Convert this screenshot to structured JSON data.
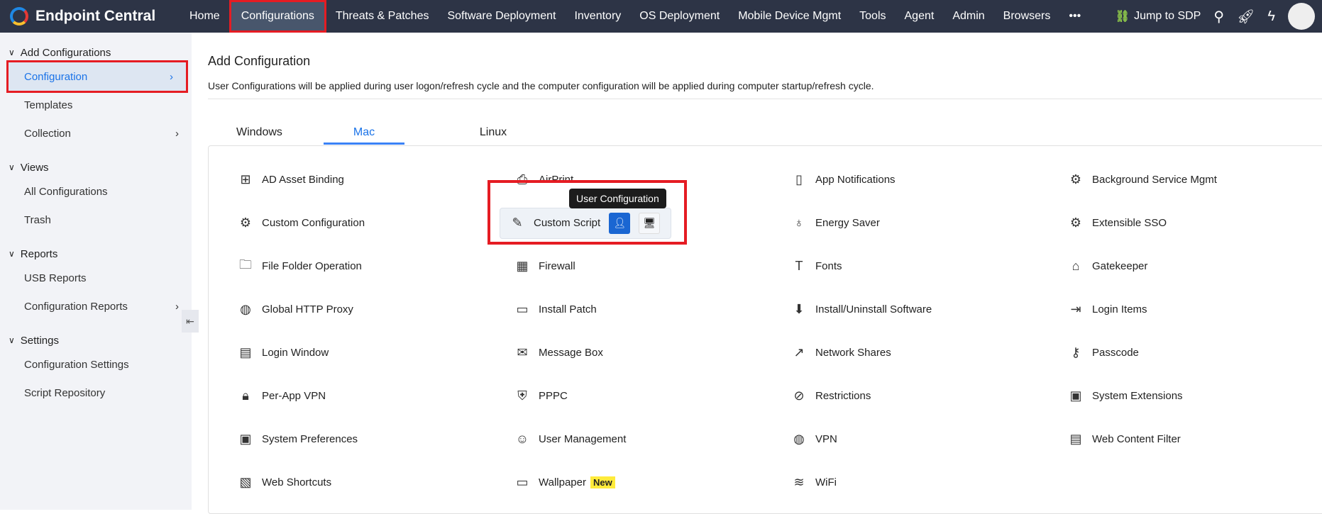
{
  "app": {
    "name": "Endpoint Central"
  },
  "nav": [
    "Home",
    "Configurations",
    "Threats & Patches",
    "Software Deployment",
    "Inventory",
    "OS Deployment",
    "Mobile Device Mgmt",
    "Tools",
    "Agent",
    "Admin",
    "Browsers",
    "•••"
  ],
  "topright": {
    "jump": "Jump to SDP"
  },
  "sidebar": {
    "add": {
      "title": "Add Configurations",
      "items": [
        "Configuration",
        "Templates",
        "Collection"
      ]
    },
    "views": {
      "title": "Views",
      "items": [
        "All Configurations",
        "Trash"
      ]
    },
    "reports": {
      "title": "Reports",
      "items": [
        "USB Reports",
        "Configuration Reports"
      ]
    },
    "settings": {
      "title": "Settings",
      "items": [
        "Configuration Settings",
        "Script Repository"
      ]
    }
  },
  "main": {
    "title": "Add Configuration",
    "desc": "User Configurations will be applied during user logon/refresh cycle and the computer configuration will be applied during computer startup/refresh cycle.",
    "tabs": [
      "Windows",
      "Mac",
      "Linux"
    ],
    "tooltip": "User Configuration",
    "new_badge": "New",
    "items": [
      "AD Asset Binding",
      "AirPrint",
      "App Notifications",
      "Background Service Mgmt",
      "Custom Configuration",
      "Custom Script",
      "Energy Saver",
      "Extensible SSO",
      "File Folder Operation",
      "Firewall",
      "Fonts",
      "Gatekeeper",
      "Global HTTP Proxy",
      "Install Patch",
      "Install/Uninstall Software",
      "Login Items",
      "Login Window",
      "Message Box",
      "Network Shares",
      "Passcode",
      "Per-App VPN",
      "PPPC",
      "Restrictions",
      "System Extensions",
      "System Preferences",
      "User Management",
      "VPN",
      "Web Content Filter",
      "Web Shortcuts",
      "Wallpaper",
      "WiFi"
    ]
  }
}
